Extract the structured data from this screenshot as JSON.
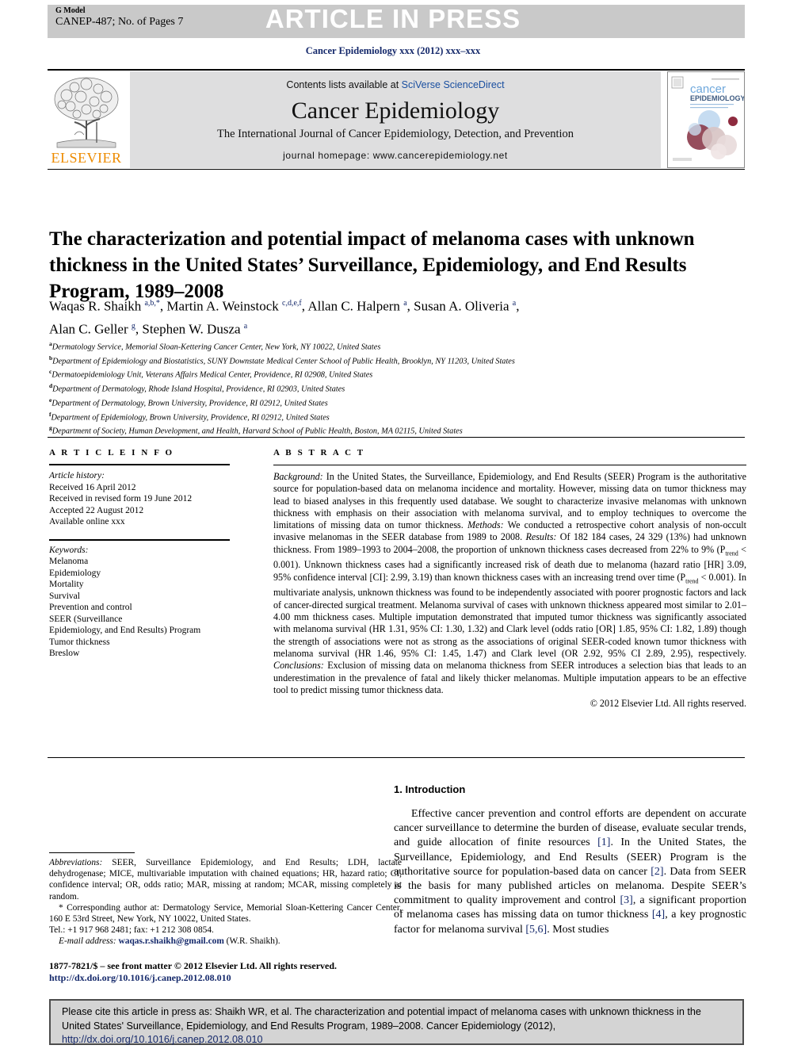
{
  "banner": {
    "g_model": "G Model",
    "model_id": "CANEP-487; No. of Pages 7",
    "article_in_press": "ARTICLE IN PRESS",
    "banner_bg": "#c9c9c9"
  },
  "journal_ref": "Cancer Epidemiology xxx (2012) xxx–xxx",
  "masthead": {
    "publisher_word": "ELSEVIER",
    "publisher_color": "#ed8b00",
    "contents_prefix": "Contents lists available at ",
    "contents_link": "SciVerse ScienceDirect",
    "journal_name": "Cancer Epidemiology",
    "journal_subtitle": "The International Journal of Cancer Epidemiology, Detection, and Prevention",
    "journal_homepage": "journal homepage: www.cancerepidemiology.net",
    "cover_title_line1": "cancer",
    "cover_title_line2": "EPIDEMIOLOGY",
    "link_color": "#1a4fa0"
  },
  "article": {
    "title": "The characterization and potential impact of melanoma cases with unknown thickness in the United States’ Surveillance, Epidemiology, and End Results Program, 1989–2008",
    "authors_line1_html": "Waqas R. Shaikh <sup>a,b,*</sup>, Martin A. Weinstock <sup>c,d,e,f</sup>, Allan C. Halpern <sup>a</sup>, Susan A. Oliveria <sup>a</sup>,",
    "authors_line2_html": "Alan C. Geller <sup>g</sup>, Stephen W. Dusza <sup>a</sup>",
    "affiliations": [
      {
        "mark": "a",
        "text": "Dermatology Service, Memorial Sloan-Kettering Cancer Center, New York, NY 10022, United States"
      },
      {
        "mark": "b",
        "text": "Department of Epidemiology and Biostatistics, SUNY Downstate Medical Center School of Public Health, Brooklyn, NY 11203, United States"
      },
      {
        "mark": "c",
        "text": "Dermatoepidemiology Unit, Veterans Affairs Medical Center, Providence, RI 02908, United States"
      },
      {
        "mark": "d",
        "text": "Department of Dermatology, Rhode Island Hospital, Providence, RI 02903, United States"
      },
      {
        "mark": "e",
        "text": "Department of Dermatology, Brown University, Providence, RI 02912, United States"
      },
      {
        "mark": "f",
        "text": "Department of Epidemiology, Brown University, Providence, RI 02912, United States"
      },
      {
        "mark": "g",
        "text": "Department of Society, Human Development, and Health, Harvard School of Public Health, Boston, MA 02115, United States"
      }
    ]
  },
  "article_info": {
    "heading": "A R T I C L E   I N F O",
    "history_label": "Article history:",
    "history": [
      "Received 16 April 2012",
      "Received in revised form 19 June 2012",
      "Accepted 22 August 2012",
      "Available online xxx"
    ],
    "keywords_label": "Keywords:",
    "keywords": [
      "Melanoma",
      "Epidemiology",
      "Mortality",
      "Survival",
      "Prevention and control",
      "SEER (Surveillance",
      "Epidemiology, and End Results) Program",
      "Tumor thickness",
      "Breslow"
    ]
  },
  "abstract": {
    "heading": "A B S T R A C T",
    "body_html": "<i>Background:</i> In the United States, the Surveillance, Epidemiology, and End Results (SEER) Program is the authoritative source for population-based data on melanoma incidence and mortality. However, missing data on tumor thickness may lead to biased analyses in this frequently used database. We sought to characterize invasive melanomas with unknown thickness with emphasis on their association with melanoma survival, and to employ techniques to overcome the limitations of missing data on tumor thickness. <i>Methods:</i> We conducted a retrospective cohort analysis of non-occult invasive melanomas in the SEER database from 1989 to 2008. <i>Results:</i> Of 182 184 cases, 24 329 (13%) had unknown thickness. From 1989–1993 to 2004–2008, the proportion of unknown thickness cases decreased from 22% to 9% (P<sub>trend</sub> &lt; 0.001). Unknown thickness cases had a significantly increased risk of death due to melanoma (hazard ratio [HR] 3.09, 95% confidence interval [CI]: 2.99, 3.19) than known thickness cases with an increasing trend over time (P<sub>trend</sub> &lt; 0.001). In multivariate analysis, unknown thickness was found to be independently associated with poorer prognostic factors and lack of cancer-directed surgical treatment. Melanoma survival of cases with unknown thickness appeared most similar to 2.01–4.00 mm thickness cases. Multiple imputation demonstrated that imputed tumor thickness was significantly associated with melanoma survival (HR 1.31, 95% CI: 1.30, 1.32) and Clark level (odds ratio [OR] 1.85, 95% CI: 1.82, 1.89) though the strength of associations were not as strong as the associations of original SEER-coded known tumor thickness with melanoma survival (HR 1.46, 95% CI: 1.45, 1.47) and Clark level (OR 2.92, 95% CI 2.89, 2.95), respectively. <i>Conclusions:</i> Exclusion of missing data on melanoma thickness from SEER introduces a selection bias that leads to an underestimation in the prevalence of fatal and likely thicker melanomas. Multiple imputation appears to be an effective tool to predict missing tumor thickness data.",
    "copyright": "© 2012 Elsevier Ltd. All rights reserved."
  },
  "introduction": {
    "heading": "1. Introduction",
    "paragraph_html": "Effective cancer prevention and control efforts are dependent on accurate cancer surveillance to determine the burden of disease, evaluate secular trends, and guide allocation of finite resources <span class=\"ref\">[1]</span>. In the United States, the Surveillance, Epidemiology, and End Results (SEER) Program is the authoritative source for population-based data on cancer <span class=\"ref\">[2]</span>. Data from SEER is the basis for many published articles on melanoma. Despite SEER’s commitment to quality improvement and control <span class=\"ref\">[3]</span>, a significant proportion of melanoma cases has missing data on tumor thickness <span class=\"ref\">[4]</span>, a key prognostic factor for melanoma survival <span class=\"ref\">[5,6]</span>. Most studies"
  },
  "footnotes": {
    "abbreviations_html": "<i>Abbreviations:</i> SEER, Surveillance Epidemiology, and End Results; LDH, lactate dehydrogenase; MICE, multivariable imputation with chained equations; HR, hazard ratio; CI, confidence interval; OR, odds ratio; MAR, missing at random; MCAR, missing completely at random.",
    "corresponding_html": "* Corresponding author at: Dermatology Service, Memorial Sloan-Kettering Cancer Center, 160 E 53rd Street, New York, NY 10022, United States.",
    "tel": "Tel.: +1 917 968 2481; fax: +1 212 308 0854.",
    "email_label": "E-mail address:",
    "email": "waqas.r.shaikh@gmail.com",
    "email_owner": "(W.R. Shaikh).",
    "front_matter": "1877-7821/$ – see front matter © 2012 Elsevier Ltd. All rights reserved.",
    "doi": "http://dx.doi.org/10.1016/j.canep.2012.08.010"
  },
  "citation_box": {
    "text_html": "Please cite this article in press as: Shaikh WR, et al. The characterization and potential impact of melanoma cases with unknown thickness in the United States' Surveillance, Epidemiology, and End Results Program, 1989–2008. Cancer Epidemiology (2012), <span class=\"doi-link\">http://dx.doi.org/10.1016/j.canep.2012.08.010</span>",
    "bg": "#d4d4d4",
    "border": "#4d4d4d"
  }
}
